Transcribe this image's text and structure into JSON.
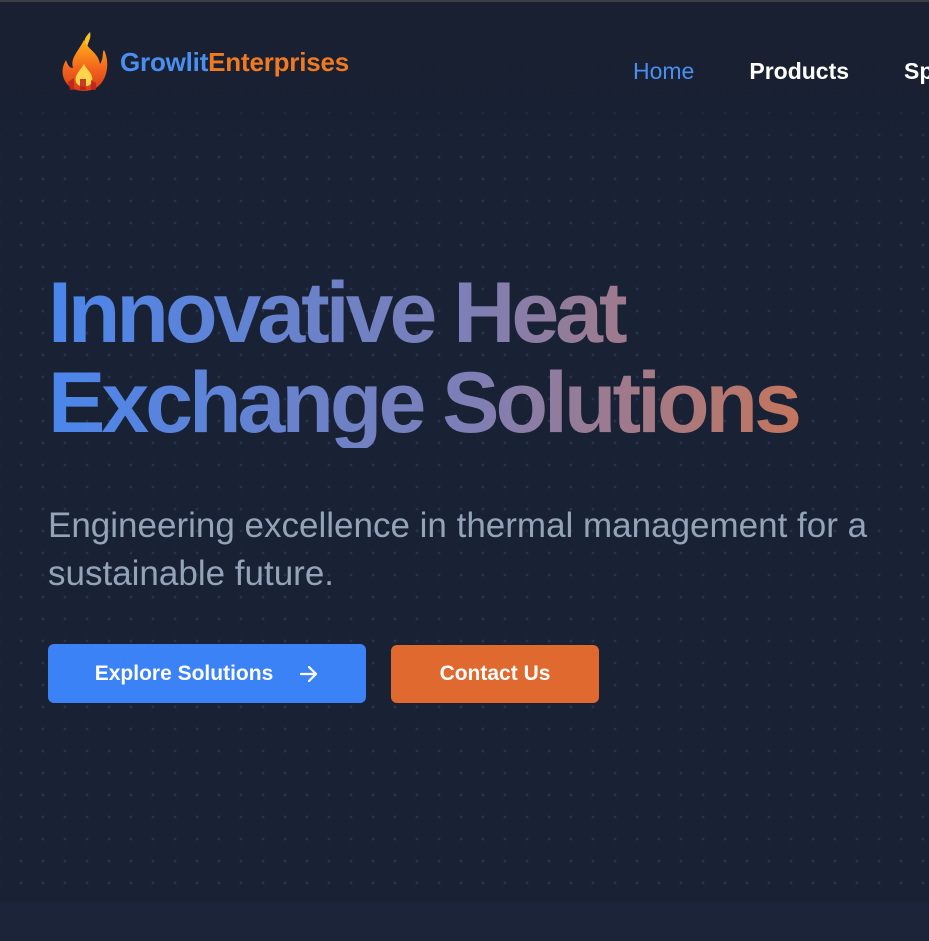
{
  "header": {
    "logo_icon": "flame-logo-icon",
    "brand_part1": "Growlit",
    "brand_part2": "Enterprises",
    "nav": [
      {
        "label": "Home",
        "active": true
      },
      {
        "label": "Products",
        "active": false
      },
      {
        "label": "Sp",
        "active": false
      }
    ]
  },
  "hero": {
    "headline_line1": "Innovative Heat",
    "headline_line2": "Exchange Solutions",
    "subtitle": "Engineering excellence in thermal management for a sustainable future.",
    "primary_button": {
      "label": "Explore Solutions",
      "icon": "arrow-right-icon"
    },
    "secondary_button": {
      "label": "Contact Us"
    }
  },
  "colors": {
    "background": "#182032",
    "accent_blue": "#3b82f6",
    "accent_orange": "#e0692f",
    "brand_blue": "#4a8ff0",
    "brand_orange": "#ef7a22",
    "subtitle": "#94a3b8"
  }
}
